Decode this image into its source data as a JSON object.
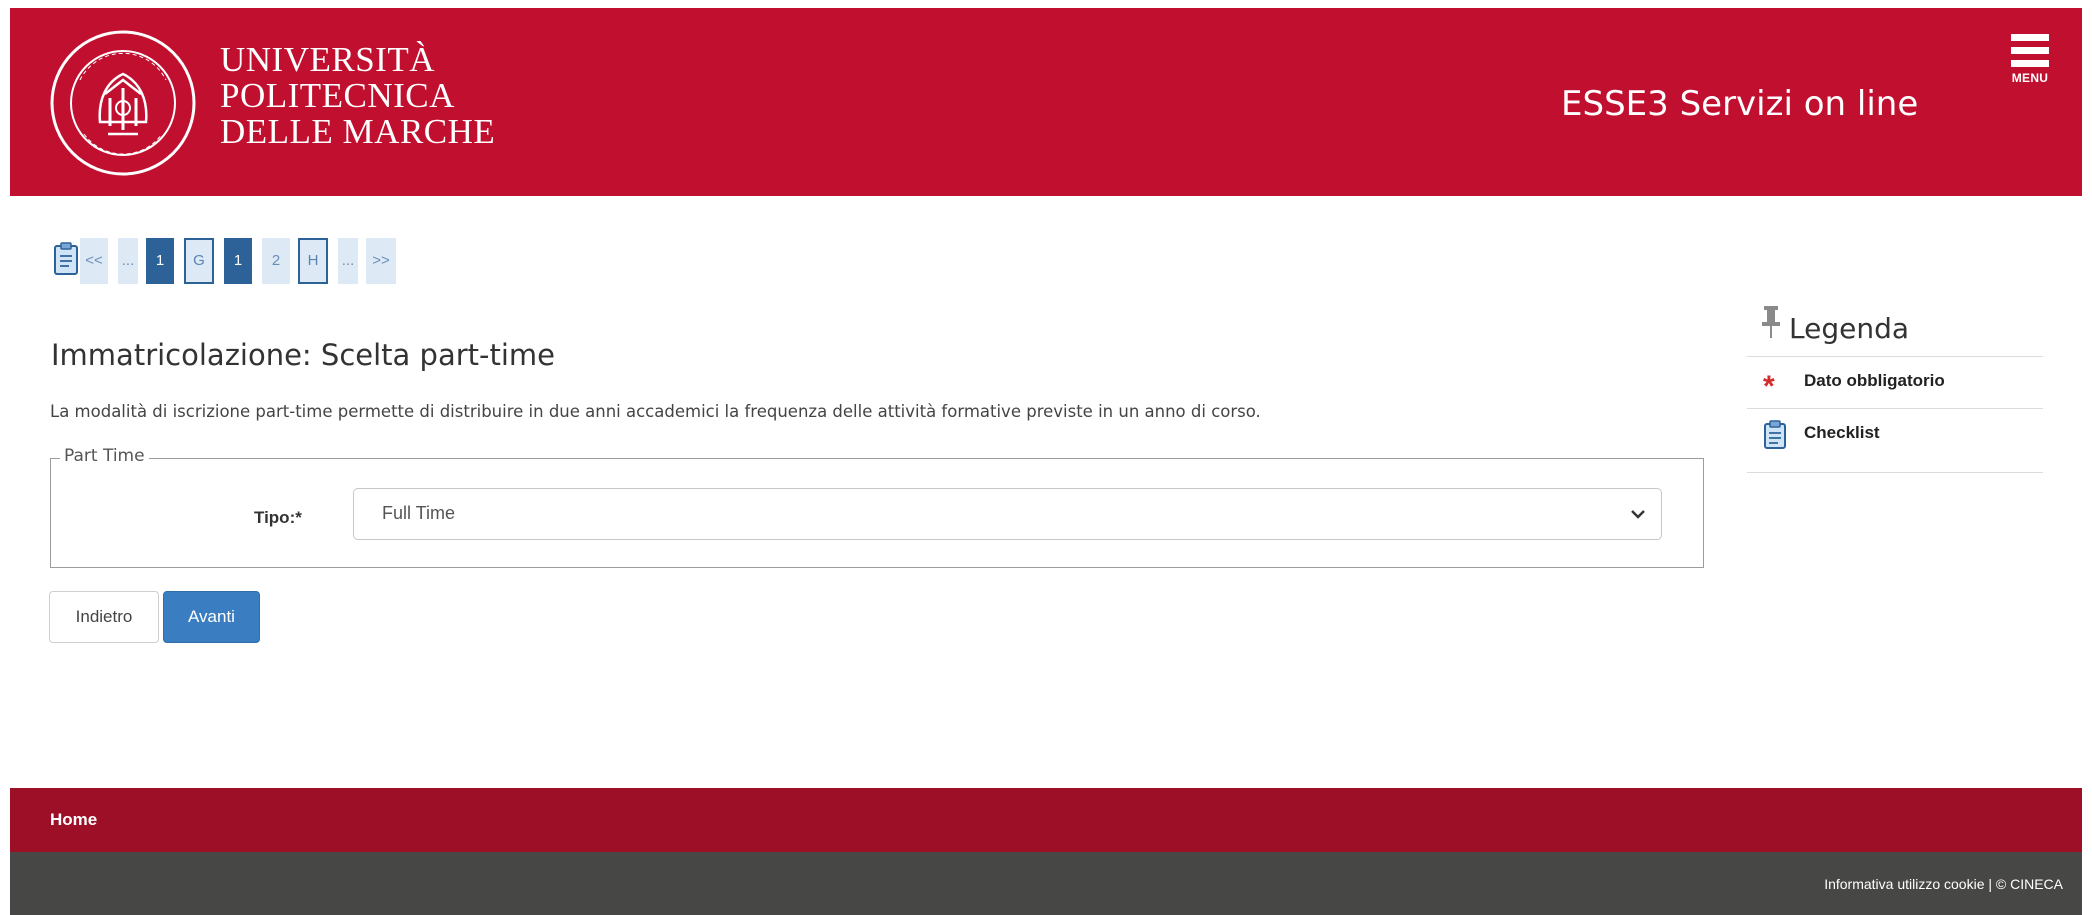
{
  "header": {
    "logo_lines": [
      "UNIVERSITÀ",
      "POLITECNICA",
      "DELLE MARCHE"
    ],
    "seal_text_top": "UNIVERSITÀ POLITECNICA",
    "seal_text_bottom": "DELLE MARCHE",
    "service_title": "ESSE3 Servizi on line",
    "menu_label": "MENU"
  },
  "pager": {
    "items": [
      "<<",
      "...",
      "1",
      "G",
      "1",
      "2",
      "H",
      "...",
      ">>"
    ]
  },
  "main": {
    "title": "Immatricolazione: Scelta part-time",
    "intro": "La modalità di iscrizione part-time permette di distribuire in due anni accademici la frequenza delle attività formative previste in un anno di corso.",
    "fieldset_legend": "Part Time",
    "tipo_label": "Tipo:*",
    "tipo_value": "Full Time",
    "back_label": "Indietro",
    "next_label": "Avanti"
  },
  "legend": {
    "title": "Legenda",
    "items": [
      {
        "icon": "asterisk-icon",
        "label": "Dato obbligatorio"
      },
      {
        "icon": "checklist-icon",
        "label": "Checklist"
      }
    ]
  },
  "footer": {
    "home_label": "Home",
    "cookie_text": "Informativa utilizzo cookie | © CINECA"
  },
  "colors": {
    "brand_red": "#c00f2f",
    "footer_red": "#9c0f27",
    "footer_gray": "#474845",
    "primary_blue": "#3a7ec1",
    "pager_dark": "#2d6299",
    "pager_light": "#dde9f5"
  }
}
